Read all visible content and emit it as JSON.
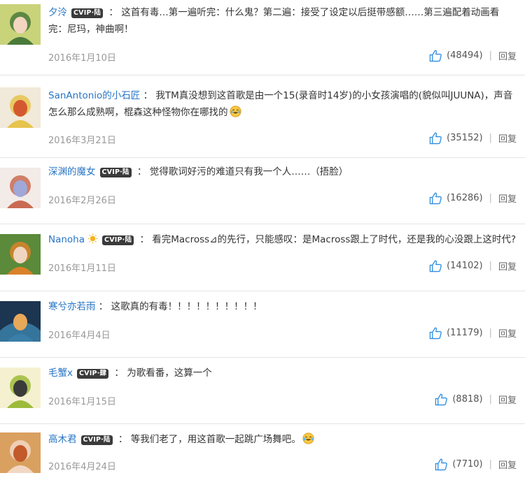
{
  "comments": [
    {
      "user": "夕泠",
      "vip": true,
      "vip_label": "CVIP·陆",
      "text": "这首有毒…第一遍听完：什么鬼？第二遍：接受了设定以后挺带感额……第三遍配着动画看完：尼玛，神曲啊！",
      "emoji_after": false,
      "date": "2016年1月10日",
      "likes": "(48494)",
      "reply": "回复",
      "avatar_colors": [
        "#c9d37a",
        "#4a7a3a",
        "#f2d6c0"
      ]
    },
    {
      "user": "SanAntonio的小石匠",
      "vip": false,
      "text": "我TM真没想到这首歌是由一个15(录音时14岁)的小女孩演唱的(貌似叫JUUNA)，声音怎么那么成熟啊，棍森这种怪物你在哪找的",
      "emoji_after": true,
      "date": "2016年3月21日",
      "likes": "(35152)",
      "reply": "回复",
      "avatar_colors": [
        "#f1e9d9",
        "#e6c44d",
        "#d4582f"
      ]
    },
    {
      "user": "深渊的魔女",
      "vip": true,
      "vip_label": "CVIP·陆",
      "text": "觉得歌词好污的难道只有我一个人……（捂脸）",
      "emoji_after": false,
      "date": "2016年2月26日",
      "likes": "(16286)",
      "reply": "回复",
      "avatar_colors": [
        "#f3ebe8",
        "#c96b52",
        "#9fa8d8"
      ]
    },
    {
      "user": "Nanoha",
      "vip": true,
      "vip_label": "CVIP·陆",
      "sun_badge": true,
      "text": "看完Macross⊿的先行，只能感叹：是Macross跟上了时代，还是我的心没跟上这时代?",
      "emoji_after": false,
      "date": "2016年1月11日",
      "likes": "(14102)",
      "reply": "回复",
      "avatar_colors": [
        "#5a8a3a",
        "#d9822b",
        "#f0d5c0"
      ]
    },
    {
      "user": "寒兮亦若雨",
      "vip": false,
      "text": "这歌真的有毒！！！！！！！！！！",
      "emoji_after": false,
      "date": "2016年4月4日",
      "likes": "(11179)",
      "reply": "回复",
      "avatar_colors": [
        "#1c3550",
        "#3a7fa8",
        "#e8a85a"
      ]
    },
    {
      "user": "毛蟹x",
      "vip": true,
      "vip_label": "CVIP·肆",
      "text": "为歌看番，这算一个",
      "emoji_after": false,
      "date": "2016年1月15日",
      "likes": "(8818)",
      "reply": "回复",
      "avatar_colors": [
        "#f5f0d0",
        "#9dbb3a",
        "#3a3a3a"
      ]
    },
    {
      "user": "高木君",
      "vip": true,
      "vip_label": "CVIP·陆",
      "text": "等我们老了，用这首歌一起跳广场舞吧。",
      "emoji_after": true,
      "date": "2016年4月24日",
      "likes": "(7710)",
      "reply": "回复",
      "avatar_colors": [
        "#d9a060",
        "#f2d7c4",
        "#c25a2a"
      ]
    }
  ],
  "colors": {
    "username": "#2775c5",
    "like_icon": "#2f8ee0",
    "date": "#999999",
    "text": "#333333"
  },
  "icons": {
    "like": "thumbs-up-icon",
    "emoji": "laughing-tears-emoji",
    "vip": "vip-badge",
    "sun": "sun-badge-icon"
  }
}
